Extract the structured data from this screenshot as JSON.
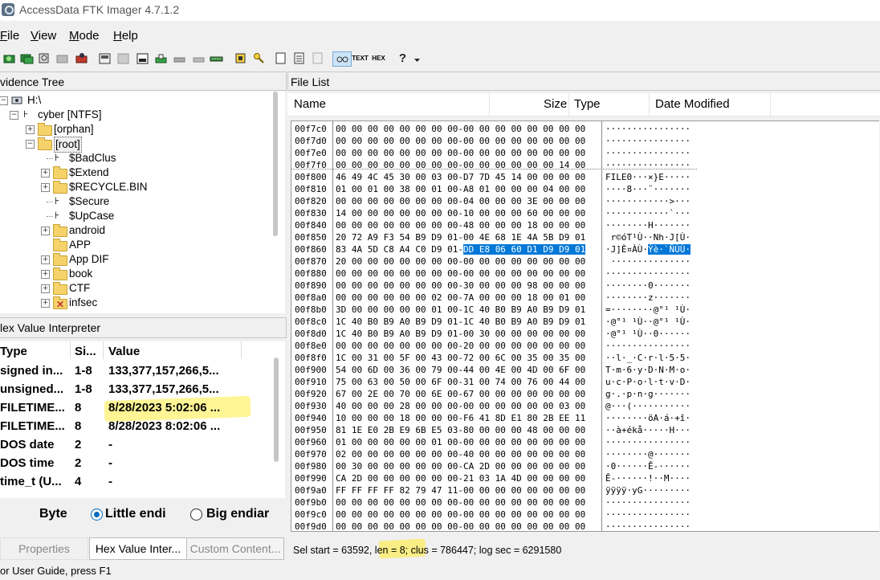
{
  "app": {
    "title": "AccessData FTK Imager 4.7.1.2"
  },
  "menu": [
    {
      "first": "F",
      "rest": "ile"
    },
    {
      "first": "V",
      "rest": "iew"
    },
    {
      "first": "M",
      "rest": "ode"
    },
    {
      "first": "H",
      "rest": "elp"
    }
  ],
  "toolbar": {
    "icons": [
      "add-evidence-icon",
      "add-all-evidence-icon",
      "image-mounting-icon",
      "remove-evidence-icon",
      "remove-all-evidence-icon",
      "create-disk-image-icon",
      "export-disk-image-icon",
      "export-logical-image-icon",
      "add-to-custom-content-icon",
      "create-custom-content-image-icon",
      "decrypt-icon",
      "verify-drive-icon",
      "capture-memory-icon",
      "obtain-protected-files-icon",
      "detect-encryption-icon",
      "export-files-icon",
      "export-hash-list-icon",
      "export-directory-listing-icon",
      "auto-view-icon",
      "text-view-icon",
      "hex-view-icon",
      "help-icon",
      "dropdown-icon"
    ],
    "text_label": "TEXT",
    "hex_label": "HEX",
    "help_glyph": "?"
  },
  "evidence_tree": {
    "title": "vidence Tree",
    "nodes": [
      {
        "label": "H:\\",
        "kind": "drive",
        "expander": "-"
      },
      {
        "label": "cyber [NTFS]",
        "kind": "partition",
        "expander": "-"
      },
      {
        "label": "[orphan]",
        "kind": "folder",
        "expander": "+"
      },
      {
        "label": "[root]",
        "kind": "folder",
        "expander": "-"
      },
      {
        "label": "$BadClus",
        "kind": "file",
        "expander": ""
      },
      {
        "label": "$Extend",
        "kind": "folder",
        "expander": "+"
      },
      {
        "label": "$RECYCLE.BIN",
        "kind": "folder",
        "expander": "+"
      },
      {
        "label": "$Secure",
        "kind": "file",
        "expander": ""
      },
      {
        "label": "$UpCase",
        "kind": "file",
        "expander": ""
      },
      {
        "label": "android",
        "kind": "folder",
        "expander": "+"
      },
      {
        "label": "APP",
        "kind": "folder",
        "expander": ""
      },
      {
        "label": "App DIF",
        "kind": "folder",
        "expander": "+"
      },
      {
        "label": "book",
        "kind": "folder",
        "expander": "+"
      },
      {
        "label": "CTF",
        "kind": "folder",
        "expander": "+"
      },
      {
        "label": "infsec",
        "kind": "deleted-folder",
        "expander": "+"
      }
    ]
  },
  "hex_interpreter": {
    "title": "lex Value Interpreter",
    "columns": [
      "Type",
      "Si...",
      "Value"
    ],
    "rows": [
      [
        "signed in...",
        "1-8",
        "133,377,157,266,5..."
      ],
      [
        "unsigned...",
        "1-8",
        "133,377,157,266,5..."
      ],
      [
        "FILETIME...",
        "8",
        "8/28/2023 5:02:06 ..."
      ],
      [
        "FILETIME...",
        "8",
        "8/28/2023 8:02:06 ..."
      ],
      [
        "DOS date",
        "2",
        "-"
      ],
      [
        "DOS time",
        "2",
        "-"
      ],
      [
        "time_t (U...",
        "4",
        "-"
      ]
    ],
    "byte_order_label": "Byte",
    "little_endian": "Little endi",
    "big_endian": "Big endiar"
  },
  "bottom_tabs": [
    "Properties",
    "Hex Value Inter...",
    "Custom Content..."
  ],
  "file_list": {
    "title": "File List",
    "columns": [
      "Name",
      "Size",
      "Type",
      "Date Modified"
    ]
  },
  "hex_view": {
    "rows": [
      {
        "off": "00f7c0",
        "hex": "00 00 00 00 00 00 00 00-00 00 00 00 00 00 00 00",
        "asc": "················"
      },
      {
        "off": "00f7d0",
        "hex": "00 00 00 00 00 00 00 00-00 00 00 00 00 00 00 00",
        "asc": "················"
      },
      {
        "off": "00f7e0",
        "hex": "00 00 00 00 00 00 00 00-00 00 00 00 00 00 00 00",
        "asc": "················"
      },
      {
        "off": "00f7f0",
        "hex": "00 00 00 00 00 00 00 00-00 00 00 00 00 00 14 00",
        "asc": "················"
      },
      {
        "off": "00f800",
        "hex": "46 49 4C 45 30 00 03 00-D7 7D 45 14 00 00 00 00",
        "asc": "FILE0···×}E·····"
      },
      {
        "off": "00f810",
        "hex": "01 00 01 00 38 00 01 00-A8 01 00 00 00 04 00 00",
        "asc": "····8···¨·······"
      },
      {
        "off": "00f820",
        "hex": "00 00 00 00 00 00 00 00-04 00 00 00 3E 00 00 00",
        "asc": "············>···"
      },
      {
        "off": "00f830",
        "hex": "14 00 00 00 00 00 00 00-10 00 00 00 60 00 00 00",
        "asc": "············`···"
      },
      {
        "off": "00f840",
        "hex": "00 00 00 00 00 00 00 00-48 00 00 00 18 00 00 00",
        "asc": "········H·······"
      },
      {
        "off": "00f850",
        "hex": "20 72 A9 F3 54 B9 D9 01-00 4E 68 1E 4A 5B D9 01",
        "asc": " r©óT¹Ù··Nh·J[Ù·"
      },
      {
        "off": "00f860",
        "hex": "83 4A 5D C8 A4 C0 D9 01-DD E8 06 60 D1 D9 D9 01",
        "asc": "·J]È¤ÀÙ·Ýè·`ÑÙÙ·",
        "sel_hex_from": 24,
        "sel_asc_from": 8
      },
      {
        "off": "00f870",
        "hex": "20 00 00 00 00 00 00 00-00 00 00 00 00 00 00 00",
        "asc": " ···············"
      },
      {
        "off": "00f880",
        "hex": "00 00 00 00 00 00 00 00-00 00 00 00 00 00 00 00",
        "asc": "················"
      },
      {
        "off": "00f890",
        "hex": "00 00 00 00 00 00 00 00-30 00 00 00 98 00 00 00",
        "asc": "········0·······"
      },
      {
        "off": "00f8a0",
        "hex": "00 00 00 00 00 00 02 00-7A 00 00 00 18 00 01 00",
        "asc": "········z·······"
      },
      {
        "off": "00f8b0",
        "hex": "3D 00 00 00 00 00 01 00-1C 40 B0 B9 A0 B9 D9 01",
        "asc": "=········@°¹ ¹Ù·"
      },
      {
        "off": "00f8c0",
        "hex": "1C 40 B0 B9 A0 B9 D9 01-1C 40 B0 B9 A0 B9 D9 01",
        "asc": "·@°¹ ¹Ù··@°¹ ¹Ù·"
      },
      {
        "off": "00f8d0",
        "hex": "1C 40 B0 B9 A0 B9 D9 01-00 30 00 00 00 00 00 00",
        "asc": "·@°¹ ¹Ù··0······"
      },
      {
        "off": "00f8e0",
        "hex": "00 00 00 00 00 00 00 00-20 00 00 00 00 00 00 00",
        "asc": "················"
      },
      {
        "off": "00f8f0",
        "hex": "1C 00 31 00 5F 00 43 00-72 00 6C 00 35 00 35 00",
        "asc": "··l·_·C·r·l·5·5·"
      },
      {
        "off": "00f900",
        "hex": "54 00 6D 00 36 00 79 00-44 00 4E 00 4D 00 6F 00",
        "asc": "T·m·6·y·D·N·M·o·"
      },
      {
        "off": "00f910",
        "hex": "75 00 63 00 50 00 6F 00-31 00 74 00 76 00 44 00",
        "asc": "u·c·P·o·l·t·v·D·"
      },
      {
        "off": "00f920",
        "hex": "67 00 2E 00 70 00 6E 00-67 00 00 00 00 00 00 00",
        "asc": "g·.·p·n·g·······"
      },
      {
        "off": "00f930",
        "hex": "40 00 00 00 28 00 00 00-00 00 00 00 00 00 03 00",
        "asc": "@···(···········"
      },
      {
        "off": "00f940",
        "hex": "10 00 00 00 18 00 00 00-F6 41 8D E1 80 2B EE 11",
        "asc": "········öA·á·+î·"
      },
      {
        "off": "00f950",
        "hex": "81 1E E0 2B E9 6B E5 03-80 00 00 00 48 00 00 00",
        "asc": "··à+ékå·····H···"
      },
      {
        "off": "00f960",
        "hex": "01 00 00 00 00 00 01 00-00 00 00 00 00 00 00 00",
        "asc": "················"
      },
      {
        "off": "00f970",
        "hex": "02 00 00 00 00 00 00 00-40 00 00 00 00 00 00 00",
        "asc": "········@·······"
      },
      {
        "off": "00f980",
        "hex": "00 30 00 00 00 00 00 00-CA 2D 00 00 00 00 00 00",
        "asc": "·0······Ê-······"
      },
      {
        "off": "00f990",
        "hex": "CA 2D 00 00 00 00 00 00-21 03 1A 4D 00 00 00 00",
        "asc": "Ê-······!··M····"
      },
      {
        "off": "00f9a0",
        "hex": "FF FF FF FF 82 79 47 11-00 00 00 00 00 00 00 00",
        "asc": "ÿÿÿÿ·yG·········"
      },
      {
        "off": "00f9b0",
        "hex": "00 00 00 00 00 00 00 00-00 00 00 00 00 00 00 00",
        "asc": "················"
      },
      {
        "off": "00f9c0",
        "hex": "00 00 00 00 00 00 00 00-00 00 00 00 00 00 00 00",
        "asc": "················"
      },
      {
        "off": "00f9d0",
        "hex": "00 00 00 00 00 00 00 00-00 00 00 00 00 00 00 00",
        "asc": "················"
      }
    ]
  },
  "status": {
    "text": "Sel start = 63592, len = 8; clus = 786447; log sec = 6291580"
  },
  "footer": {
    "text": "or User Guide, press F1"
  },
  "colors": {
    "selection": "#0078d7",
    "highlighter": "#ffec3d"
  }
}
